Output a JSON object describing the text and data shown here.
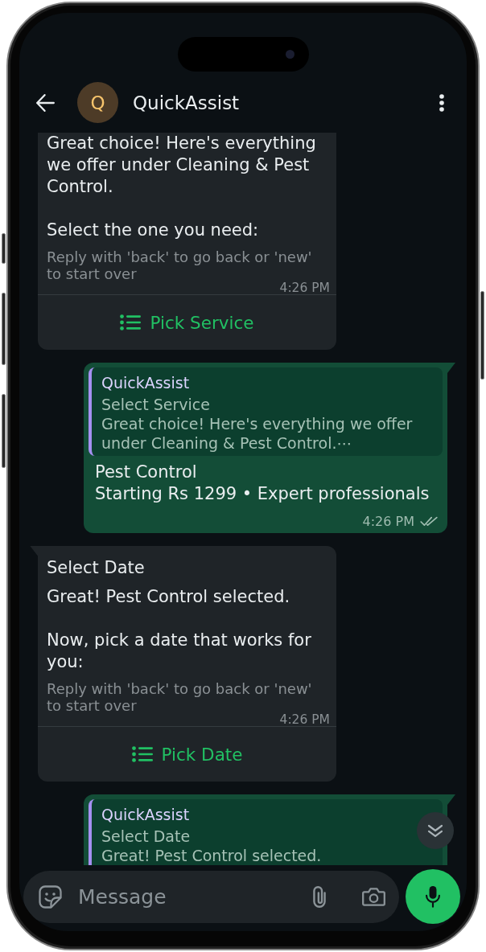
{
  "header": {
    "avatar_letter": "Q",
    "title": "QuickAssist"
  },
  "messages": [
    {
      "kind": "incoming",
      "body": "Great choice! Here's everything we offer under Cleaning & Pest Control.\n\nSelect the one you need:",
      "footer": "Reply with 'back' to go back or 'new' to start over",
      "time": "4:26 PM",
      "action": "Pick Service"
    },
    {
      "kind": "outgoing",
      "quote": {
        "sender": "QuickAssist",
        "title": "Select Service",
        "text": "Great choice! Here's everything we offer under Cleaning & Pest Control.⋯"
      },
      "title": "Pest Control",
      "body": "Starting Rs 1299 • Expert professionals",
      "time": "4:26 PM",
      "read": false
    },
    {
      "kind": "incoming",
      "header": "Select Date",
      "body": "Great! Pest Control selected.\n\nNow, pick a date that works for you:",
      "footer": "Reply with 'back' to go back or 'new' to start over",
      "time": "4:26 PM",
      "action": "Pick Date"
    },
    {
      "kind": "outgoing",
      "quote": {
        "sender": "QuickAssist",
        "title": "Select Date",
        "text": "Great! Pest Control selected."
      }
    }
  ],
  "composer": {
    "placeholder": "Message"
  }
}
